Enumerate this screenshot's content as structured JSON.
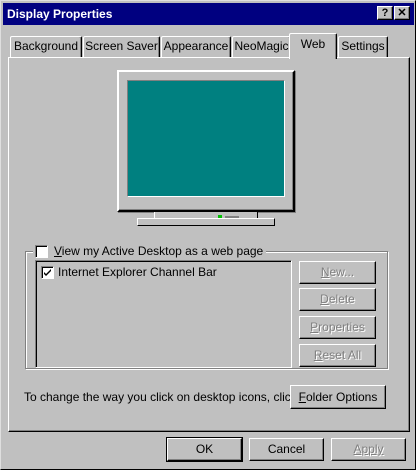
{
  "window": {
    "title": "Display Properties",
    "help_button": "?",
    "close_button": "✕"
  },
  "tabs": [
    {
      "label": "Background",
      "active": false
    },
    {
      "label": "Screen Saver",
      "active": false
    },
    {
      "label": "Appearance",
      "active": false
    },
    {
      "label": "NeoMagic",
      "active": false
    },
    {
      "label": "Web",
      "active": true
    },
    {
      "label": "Settings",
      "active": false
    }
  ],
  "web_tab": {
    "active_desktop": {
      "label_pre": "",
      "label_accel": "V",
      "label_post": "iew my Active Desktop as a web page",
      "checked": false
    },
    "items": [
      {
        "label": "Internet Explorer Channel Bar",
        "checked": true
      }
    ],
    "buttons": {
      "new": {
        "pre": "",
        "accel": "N",
        "post": "ew...",
        "enabled": false
      },
      "delete": {
        "pre": "",
        "accel": "D",
        "post": "elete",
        "enabled": false
      },
      "properties": {
        "pre": "",
        "accel": "P",
        "post": "roperties",
        "enabled": false
      },
      "reset_all": {
        "pre": "",
        "accel": "R",
        "post": "eset All",
        "enabled": false
      }
    },
    "folder_prompt": "To change the way you click on desktop icons, click:",
    "folder_options": {
      "pre": "",
      "accel": "F",
      "post": "older Options"
    }
  },
  "dialog_buttons": {
    "ok": "OK",
    "cancel": "Cancel",
    "apply": "Apply"
  },
  "colors": {
    "titlebar": "#000080",
    "face": "#c0c0c0",
    "desktop_screen": "#008080"
  }
}
